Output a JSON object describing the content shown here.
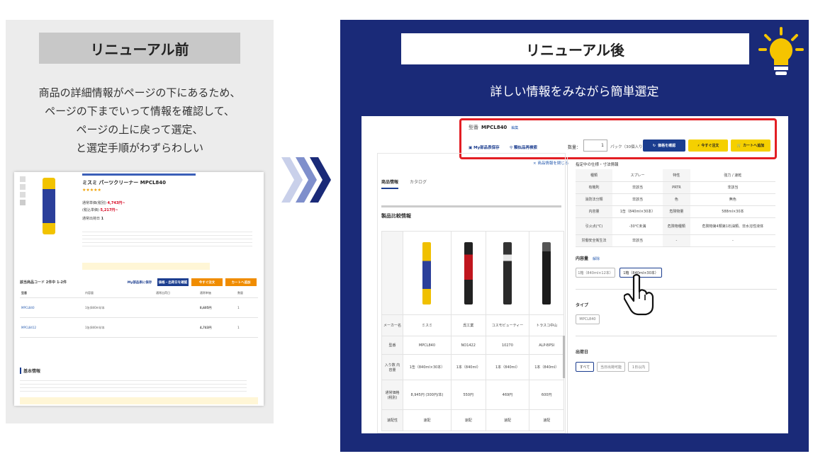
{
  "before": {
    "title": "リニューアル前",
    "description_lines": [
      "商品の詳細情報がページの下にあるため、",
      "ページの下までいって情報を確認して、",
      "ページの上に戻って選定、",
      "と選定手順がわずらわしい"
    ],
    "old_page": {
      "product_title": "ミスミ パーツクリーナー MPCL840",
      "price_1": "4,743円~",
      "price_2": "5,217円~",
      "qty": "1",
      "list_header": "該当商品コード 2件中 1-2件",
      "section_basic": "基本情報",
      "rows": [
        {
          "code": "MPCL840",
          "spec": "1缶(840ml)/本",
          "price": "8,605円",
          "qty": "1"
        },
        {
          "code": "MPCL8412",
          "spec": "1缶(840ml)/本",
          "price": "4,743円",
          "qty": "1"
        }
      ],
      "buttons": [
        "My部品表に保存",
        "価格・出荷日を確認",
        "今すぐ注文",
        "カートへ追加"
      ],
      "colors": {
        "blue": "#1b3d8f",
        "orange": "#f08c00",
        "red": "#d6001c"
      }
    }
  },
  "after": {
    "title": "リニューアル後",
    "subtitle": "詳しい情報をみながら簡単選定",
    "new_page": {
      "model_prefix": "型番",
      "model": "MPCL840",
      "model_link": "編集",
      "link_save": "My部品表保存",
      "link_similar": "類似品再検索",
      "qty_label": "数量：",
      "qty_value": "1",
      "pack_label": "パック（30個入り）",
      "btn_price": "価格を確認",
      "btn_order": "今すぐ注文",
      "btn_cart": "カートへ追加",
      "close_link": "× 商品情報を閉じる",
      "tabs": [
        "商品情報",
        "カタログ"
      ],
      "compare_title": "製品比較情報",
      "compare": {
        "makers_label": "メーカー名",
        "makers": [
          "ミスミ",
          "呉工業",
          "コスモビューティー",
          "トラスコ中山"
        ],
        "code_label": "型番",
        "codes": [
          "MPCL840",
          "NO1422",
          "10270",
          "ALP-BPSI"
        ],
        "qty_label": "入り数 内容量",
        "qtys": [
          "1缶（840ml×30本）",
          "1本（840ml）",
          "1本（840ml）",
          "1本（840ml）"
        ],
        "price_label": "通常価格(税別)",
        "prices": [
          "8,945円 (300円/本)",
          "550円",
          "469円",
          "600円"
        ],
        "ship_label": "速配性",
        "ships": [
          "速配",
          "速配",
          "速配",
          "速配"
        ],
        "bottle_colors": [
          "#f0c000",
          "#222222",
          "#2a2a2a",
          "#1c1c1c"
        ]
      },
      "spec_title": "指定中の仕様・寸法情報",
      "spec_rows": [
        [
          "種類",
          "スプレー",
          "特性",
          "強力 / 速乾"
        ],
        [
          "有機則",
          "非該当",
          "PRTR",
          "非該当"
        ],
        [
          "消防法分類",
          "非該当",
          "色",
          "無色"
        ],
        [
          "内容量",
          "1缶（840ml×30本）",
          "危険物量",
          "588ml×30本"
        ],
        [
          "引火点(℃)",
          "-30℃未満",
          "危険物種類",
          "危険物第4類第1石油類、非水溶性液体"
        ],
        [
          "労働安全衛生法",
          "非該当",
          "-",
          "-"
        ]
      ],
      "section_capacity": "内容量",
      "capacity_link": "解除",
      "capacity_options": [
        "1箱（840ml×12本）",
        "1箱（840ml×30本）"
      ],
      "section_type": "タイプ",
      "type_options": [
        "MPCL840"
      ],
      "section_ship": "出荷日",
      "ship_options": [
        "すべて",
        "当日出荷可能",
        "1日以内"
      ]
    }
  }
}
